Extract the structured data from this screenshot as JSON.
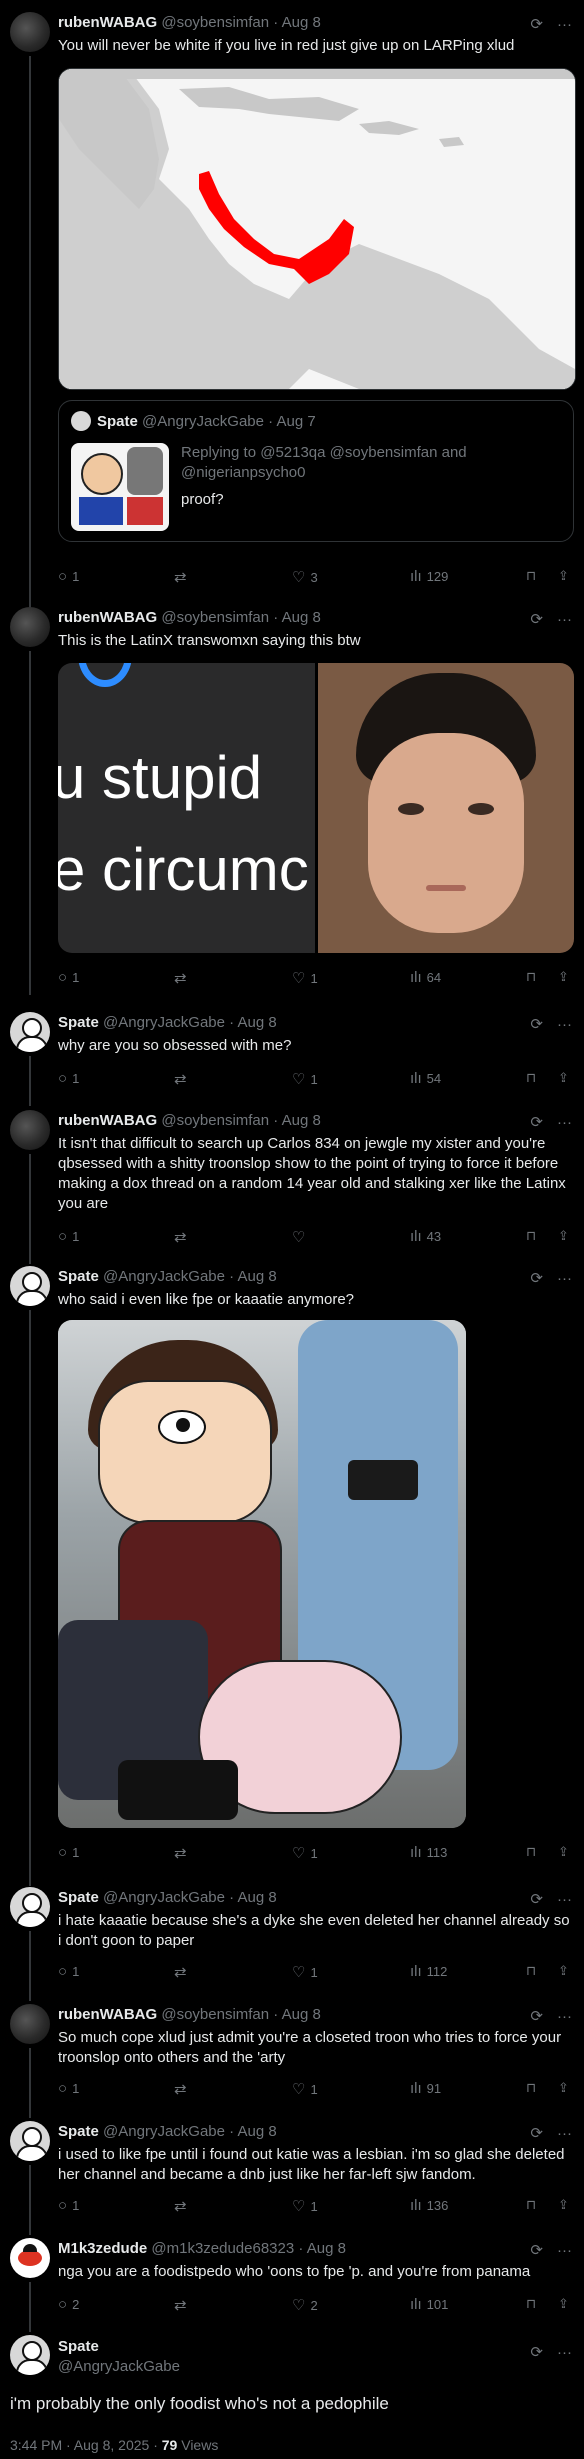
{
  "tweets": [
    {
      "name": "rubenWABAG",
      "handle": "@soybensimfan",
      "date": "Aug 8",
      "text": "You will never be white if you live in red just give up on LARPing xlud",
      "replies": "1",
      "retweets": "",
      "likes": "3",
      "views": "129",
      "quote": {
        "name": "Spate",
        "handle": "@AngryJackGabe",
        "date": "Aug 7",
        "replying": "Replying to @5213qa @soybensimfan and @nigerianpsycho0",
        "text": "proof?"
      }
    },
    {
      "name": "rubenWABAG",
      "handle": "@soybensimfan",
      "date": "Aug 8",
      "text": "This is the LatinX transwomxn saying this btw",
      "replies": "1",
      "retweets": "",
      "likes": "1",
      "views": "64",
      "media_text_1": "u stupid",
      "media_text_2": "e circumc"
    },
    {
      "name": "Spate",
      "handle": "@AngryJackGabe",
      "date": "Aug 8",
      "text": "why are you so obsessed with me?",
      "replies": "1",
      "retweets": "",
      "likes": "1",
      "views": "54"
    },
    {
      "name": "rubenWABAG",
      "handle": "@soybensimfan",
      "date": "Aug 8",
      "text": "It isn't that difficult to search up Carlos 834 on jewgle my xister and you're qbsessed with a shitty troonslop show to the point of trying to force it before making a dox thread on a random 14 year old and stalking xer like the Latinx you are",
      "replies": "1",
      "retweets": "",
      "likes": "",
      "views": "43"
    },
    {
      "name": "Spate",
      "handle": "@AngryJackGabe",
      "date": "Aug 8",
      "text": "who said i even like fpe or kaaatie anymore?",
      "replies": "1",
      "retweets": "",
      "likes": "1",
      "views": "113"
    },
    {
      "name": "Spate",
      "handle": "@AngryJackGabe",
      "date": "Aug 8",
      "text": "i hate kaaatie because she's a dyke she even deleted her channel already so i don't goon to paper",
      "replies": "1",
      "retweets": "",
      "likes": "1",
      "views": "112"
    },
    {
      "name": "rubenWABAG",
      "handle": "@soybensimfan",
      "date": "Aug 8",
      "text": "So much cope xlud just admit you're a closeted troon who tries to force your troonslop onto others and the 'arty",
      "replies": "1",
      "retweets": "",
      "likes": "1",
      "views": "91"
    },
    {
      "name": "Spate",
      "handle": "@AngryJackGabe",
      "date": "Aug 8",
      "text": "i used to like fpe until i found out katie was a lesbian. i'm so glad she deleted her channel and became a dnb just like her far-left sjw fandom.",
      "replies": "1",
      "retweets": "",
      "likes": "1",
      "views": "136"
    },
    {
      "name": "M1k3zedude",
      "handle": "@m1k3zedude68323",
      "date": "Aug 8",
      "text": "nga you are a foodistpedo who 'oons to fpe 'p. and you're from panama",
      "replies": "2",
      "retweets": "",
      "likes": "2",
      "views": "101"
    }
  ],
  "main": {
    "name": "Spate",
    "handle": "@AngryJackGabe",
    "text": "i'm probably the only foodist who's not a pedophile",
    "time": "3:44 PM · Aug 8, 2025 · ",
    "views_count": "79",
    "views_label": " Views"
  },
  "colors": {
    "bg": "#000000",
    "text": "#e7e9ea",
    "muted": "#71767b",
    "highlight_red": "#ff0000"
  }
}
